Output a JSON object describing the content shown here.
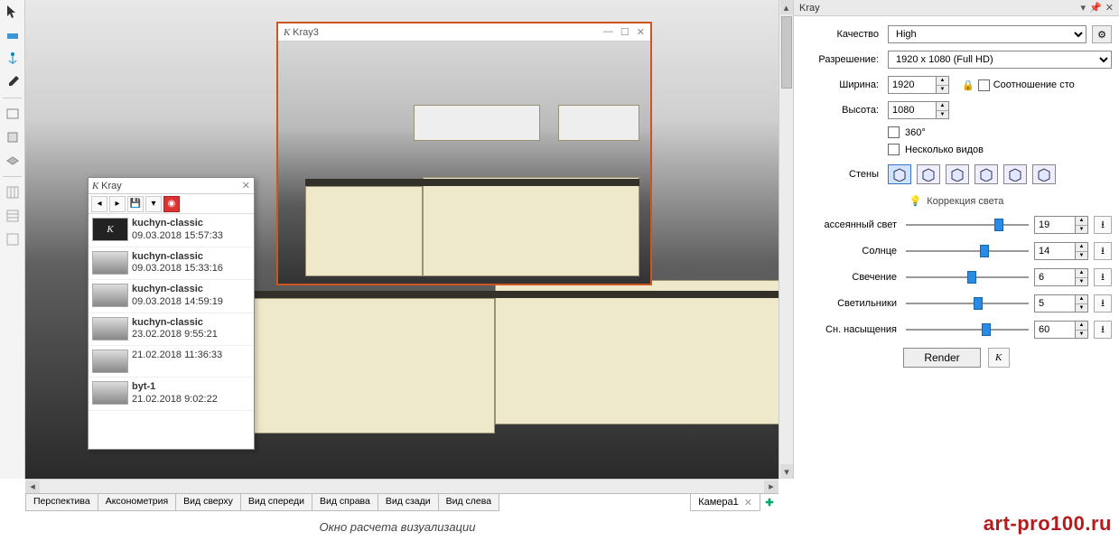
{
  "left_toolbar": {
    "tools": [
      "select",
      "fill",
      "color-anchor",
      "dropper",
      "shape",
      "box",
      "layer",
      "grid-a",
      "grid-b",
      "grid-c"
    ]
  },
  "list_panel": {
    "title": "Kray",
    "items": [
      {
        "name": "kuchyn-classic",
        "date": "09.03.2018 15:57:33"
      },
      {
        "name": "kuchyn-classic",
        "date": "09.03.2018 15:33:16"
      },
      {
        "name": "kuchyn-classic",
        "date": "09.03.2018 14:59:19"
      },
      {
        "name": "kuchyn-classic",
        "date": "23.02.2018 9:55:21"
      },
      {
        "name": "",
        "date": "21.02.2018 11:36:33"
      },
      {
        "name": "byt-1",
        "date": "21.02.2018 9:02:22"
      }
    ]
  },
  "render_overlay": {
    "title": "Kray3"
  },
  "view_tabs": {
    "tabs": [
      "Перспектива",
      "Аксонометрия",
      "Вид сверху",
      "Вид спереди",
      "Вид справа",
      "Вид сзади",
      "Вид слева"
    ],
    "camera_tab": "Камера1"
  },
  "kray": {
    "title": "Kray",
    "quality_label": "Качество",
    "quality_value": "High",
    "resolution_label": "Разрешение:",
    "resolution_value": "1920 x 1080 (Full HD)",
    "width_label": "Ширина:",
    "width_value": "1920",
    "height_label": "Высота:",
    "height_value": "1080",
    "aspect_label": "Соотношение сто",
    "cb360_label": "360°",
    "multi_views_label": "Несколько видов",
    "walls_label": "Стены",
    "light_correction_label": "Коррекция света",
    "sliders": [
      {
        "label": "ассеянный свет",
        "value": "19",
        "pos": 72
      },
      {
        "label": "Солнце",
        "value": "14",
        "pos": 60
      },
      {
        "label": "Свечение",
        "value": "6",
        "pos": 50
      },
      {
        "label": "Светильники",
        "value": "5",
        "pos": 55
      },
      {
        "label": "Сн. насыщения",
        "value": "60",
        "pos": 62
      }
    ],
    "render_label": "Render"
  },
  "caption": "Окно расчета визуализации",
  "watermark": "art-pro100.ru"
}
